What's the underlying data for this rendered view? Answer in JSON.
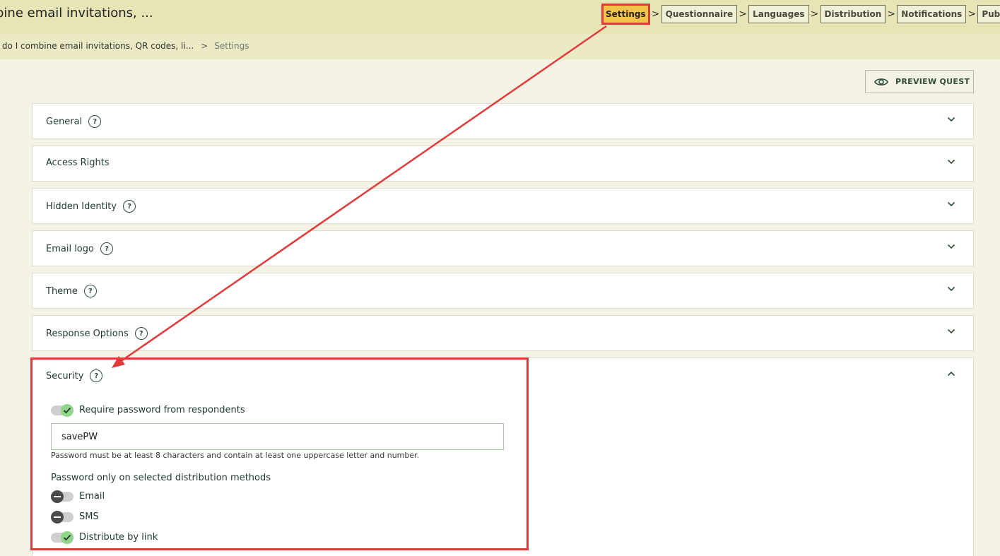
{
  "header": {
    "title": "bine email invitations, ...",
    "steps": [
      "Settings",
      "Questionnaire",
      "Languages",
      "Distribution",
      "Notifications",
      "Publish"
    ],
    "active_step": "Settings",
    "step_separator": ">"
  },
  "breadcrumb": {
    "parent": "v do I combine email invitations, QR codes, li...",
    "separator": ">",
    "current": "Settings"
  },
  "toolbar": {
    "preview_label": "PREVIEW QUEST"
  },
  "panels": [
    {
      "title": "General",
      "help": true
    },
    {
      "title": "Access Rights",
      "help": false
    },
    {
      "title": "Hidden Identity",
      "help": true
    },
    {
      "title": "Email logo",
      "help": true
    },
    {
      "title": "Theme",
      "help": true
    },
    {
      "title": "Response Options",
      "help": true
    }
  ],
  "security": {
    "title": "Security",
    "help": "?",
    "require_password": {
      "label": "Require password from respondents",
      "on": true
    },
    "password_value": "savePW",
    "password_hint": "Password must be at least 8 characters and contain at least one uppercase letter and number.",
    "methods_heading": "Password only on selected distribution methods",
    "methods": [
      {
        "label": "Email",
        "on": false
      },
      {
        "label": "SMS",
        "on": false
      },
      {
        "label": "Distribute by link",
        "on": true
      }
    ]
  },
  "colors": {
    "highlight": "#e03a3a",
    "active_step": "#f3c24a",
    "toggle_on": "#8fd68a",
    "toggle_off": "#4a4a4a"
  }
}
